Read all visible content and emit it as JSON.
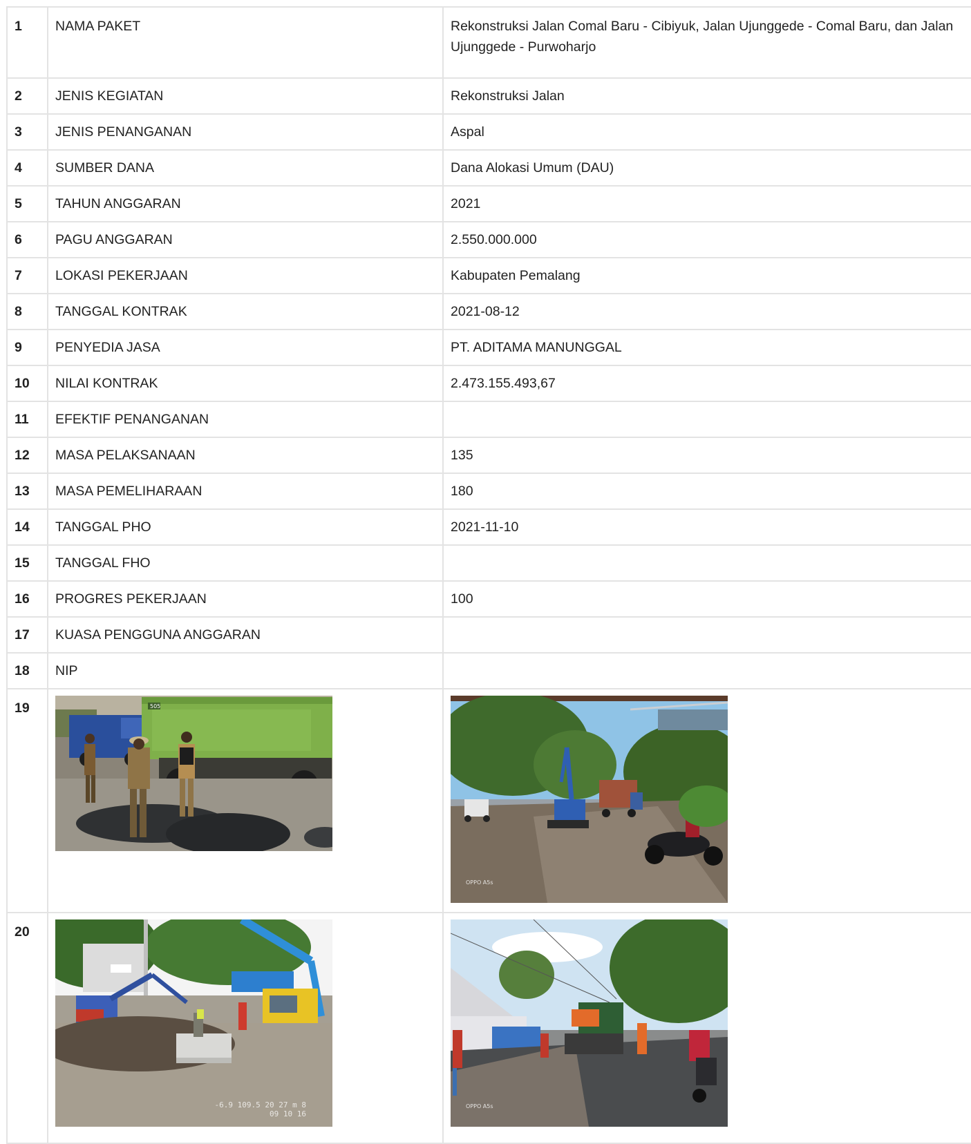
{
  "rows": [
    {
      "no": "1",
      "label": "NAMA PAKET",
      "value": "Rekonstruksi Jalan Comal Baru - Cibiyuk, Jalan Ujunggede - Comal Baru, dan Jalan Ujunggede - Purwoharjo"
    },
    {
      "no": "2",
      "label": "JENIS KEGIATAN",
      "value": "Rekonstruksi Jalan"
    },
    {
      "no": "3",
      "label": "JENIS PENANGANAN",
      "value": "Aspal"
    },
    {
      "no": "4",
      "label": "SUMBER DANA",
      "value": "Dana Alokasi Umum (DAU)"
    },
    {
      "no": "5",
      "label": "TAHUN ANGGARAN",
      "value": "2021"
    },
    {
      "no": "6",
      "label": "PAGU ANGGARAN",
      "value": "2.550.000.000"
    },
    {
      "no": "7",
      "label": "LOKASI PEKERJAAN",
      "value": "Kabupaten Pemalang"
    },
    {
      "no": "8",
      "label": "TANGGAL KONTRAK",
      "value": "2021-08-12"
    },
    {
      "no": "9",
      "label": "PENYEDIA JASA",
      "value": "PT. ADITAMA MANUNGGAL"
    },
    {
      "no": "10",
      "label": "NILAI KONTRAK",
      "value": "2.473.155.493,67"
    },
    {
      "no": "11",
      "label": "EFEKTIF PENANGANAN",
      "value": ""
    },
    {
      "no": "12",
      "label": "MASA PELAKSANAAN",
      "value": "135"
    },
    {
      "no": "13",
      "label": "MASA PEMELIHARAAN",
      "value": "180"
    },
    {
      "no": "14",
      "label": "TANGGAL PHO",
      "value": "2021-11-10"
    },
    {
      "no": "15",
      "label": "TANGGAL FHO",
      "value": ""
    },
    {
      "no": "16",
      "label": "PROGRES PEKERJAAN",
      "value": "100"
    },
    {
      "no": "17",
      "label": "KUASA PENGGUNA ANGGARAN",
      "value": ""
    },
    {
      "no": "18",
      "label": "NIP",
      "value": ""
    }
  ],
  "photo_rows": [
    {
      "no": "19"
    },
    {
      "no": "20"
    }
  ],
  "photos": {
    "truck_number": "505",
    "camera_caption": "OPPO A5s",
    "stamp_line1": "-6.9 109.5 20 27 m 8",
    "stamp_line2": "09 10 16"
  },
  "colors": {
    "border": "#e3e3e3",
    "text": "#222222"
  }
}
